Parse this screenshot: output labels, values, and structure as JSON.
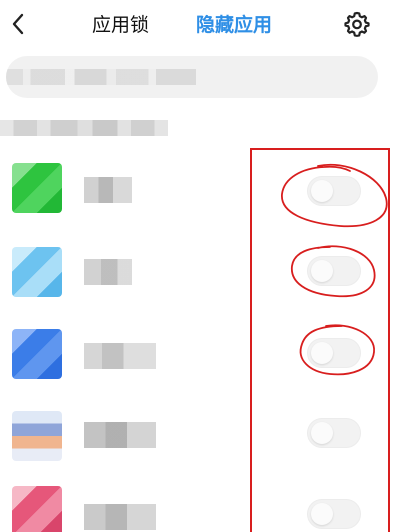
{
  "header": {
    "back_icon": "chevron-left-icon",
    "tab_app_lock": "应用锁",
    "tab_hidden_apps": "隐藏应用",
    "settings_icon": "gear-icon",
    "accent_color": "#2f8fe6"
  },
  "search": {
    "placeholder": ""
  },
  "section": {
    "label": ""
  },
  "apps": [
    {
      "name": "",
      "icon_color": "#3ccf4e",
      "hidden": false
    },
    {
      "name": "",
      "icon_color": "#8ed3f5",
      "hidden": false
    },
    {
      "name": "",
      "icon_color": "#4c8bf0",
      "hidden": false
    },
    {
      "name": "",
      "icon_color": "#b9c6e6",
      "hidden": false
    },
    {
      "name": "",
      "icon_color": "#ec7a95",
      "hidden": false
    }
  ],
  "annotation": {
    "color": "#d81e1e"
  }
}
